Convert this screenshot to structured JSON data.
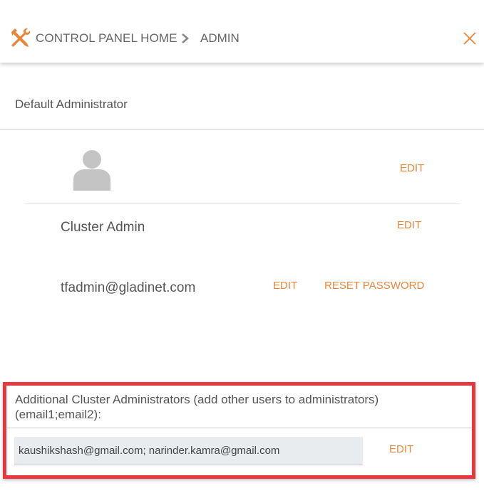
{
  "header": {
    "breadcrumb_home": "CONTROL PANEL HOME",
    "breadcrumb_current": "ADMIN"
  },
  "section": {
    "title": "Default Administrator"
  },
  "avatar_row": {
    "edit_label": "EDIT"
  },
  "name_row": {
    "name": "Cluster Admin",
    "edit_label": "EDIT"
  },
  "email_row": {
    "email": "tfadmin@gladinet.com",
    "edit_label": "EDIT",
    "reset_label": "RESET PASSWORD"
  },
  "additional": {
    "label": "Additional Cluster Administrators (add other users to administrators) (email1;email2):",
    "emails_value": "kaushikshash@gmail.com; narinder.kamra@gmail.com",
    "edit_label": "EDIT"
  },
  "colors": {
    "accent": "#e8873a",
    "highlight": "#e8383f",
    "input_bg": "#e8ecef"
  }
}
